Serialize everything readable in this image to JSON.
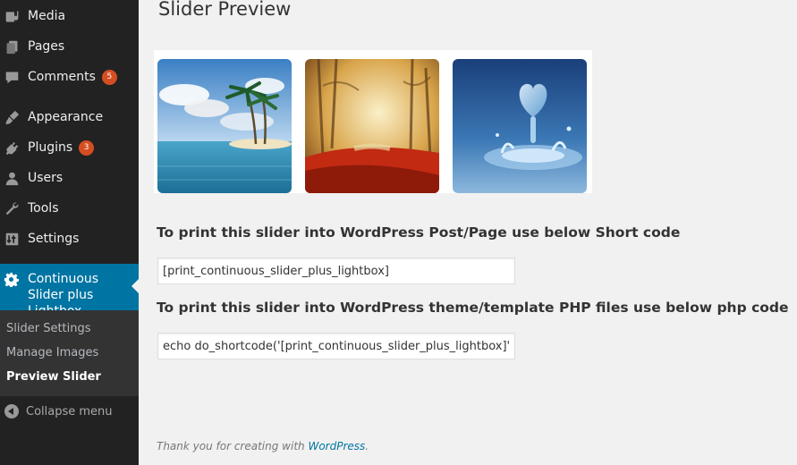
{
  "sidebar": {
    "items": [
      {
        "label": "Media",
        "icon": "media-icon"
      },
      {
        "label": "Pages",
        "icon": "pages-icon"
      },
      {
        "label": "Comments",
        "icon": "comments-icon",
        "badge": "5"
      },
      {
        "label": "Appearance",
        "icon": "appearance-icon"
      },
      {
        "label": "Plugins",
        "icon": "plugins-icon",
        "badge": "3"
      },
      {
        "label": "Users",
        "icon": "users-icon"
      },
      {
        "label": "Tools",
        "icon": "tools-icon"
      },
      {
        "label": "Settings",
        "icon": "settings-icon"
      }
    ],
    "active": {
      "label": "Continuous Slider plus Lightbox",
      "icon": "gear-icon"
    },
    "submenu": [
      {
        "label": "Slider Settings"
      },
      {
        "label": "Manage Images"
      },
      {
        "label": "Preview Slider",
        "current": true
      }
    ],
    "collapse_label": "Collapse menu"
  },
  "main": {
    "title": "Slider Preview",
    "images": [
      {
        "name": "tropical-island-image"
      },
      {
        "name": "autumn-path-image"
      },
      {
        "name": "water-heart-image"
      }
    ],
    "shortcode_heading": "To print this slider into WordPress Post/Page use below Short code",
    "shortcode_value": "[print_continuous_slider_plus_lightbox]",
    "php_heading": "To print this slider into WordPress theme/template PHP files use below php code",
    "php_value": "echo do_shortcode('[print_continuous_slider_plus_lightbox]');"
  },
  "footer": {
    "text": "Thank you for creating with ",
    "link": "WordPress",
    "suffix": "."
  },
  "colors": {
    "sidebar_bg": "#222222",
    "active_bg": "#0074a2",
    "badge": "#d54e21",
    "page_bg": "#f1f1f1"
  }
}
